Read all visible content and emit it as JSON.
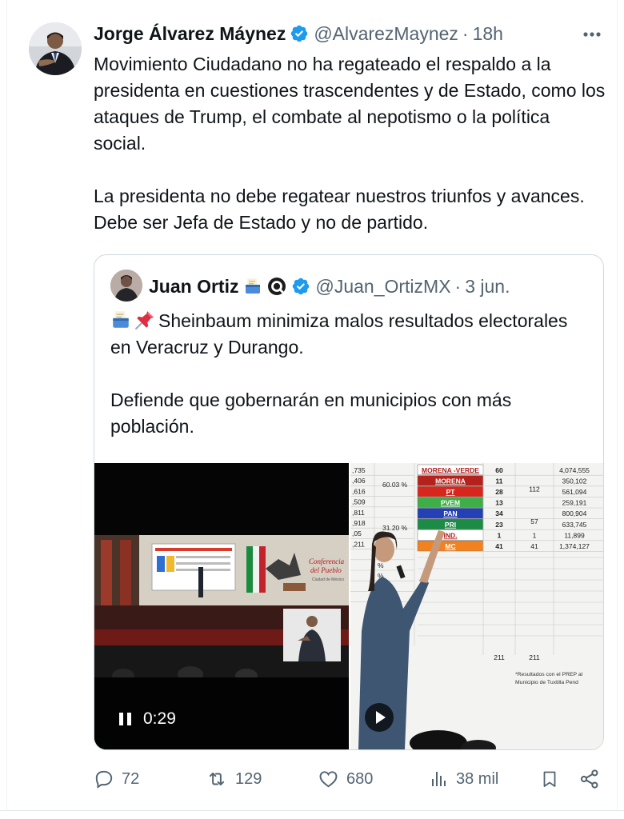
{
  "tweet": {
    "author_name": "Jorge Álvarez Máynez",
    "handle": "@AlvarezMaynez",
    "separator": "·",
    "time": "18h",
    "paragraphs": [
      "Movimiento Ciudadano no ha regateado el respaldo a la presidenta en cuestiones trascendentes y de Estado, como los ataques de Trump, el combate al nepotismo o la política social.",
      "La presidenta no debe regatear nuestros triunfos y avances. Debe ser Jefa de Estado y no de partido."
    ]
  },
  "quote": {
    "author_name": "Juan Ortiz",
    "handle": "@Juan_OrtizMX",
    "separator": "·",
    "time": "3 jun.",
    "paragraph1": "Sheinbaum minimiza malos resultados electorales en Veracruz y Durango.",
    "paragraph2": "Defiende que gobernarán en municipios con más población.",
    "video": {
      "elapsed": "0:29",
      "slide_title": "Conferencia\ndel Pueblo",
      "slide_subtitle": "Ciudad de México"
    },
    "results_table": {
      "left_numbers": [
        ",735",
        ",406",
        ",616",
        ",509",
        ",811",
        ",918",
        ",05",
        ",211",
        "",
        "",
        "",
        "",
        ""
      ],
      "percent_top": "60.03 %",
      "percent_bottom": "31.20 %",
      "rows": [
        {
          "party": "MORENA -VERDE",
          "seats": "60",
          "group": "",
          "votes": "4,074,555",
          "color": "#ffffff"
        },
        {
          "party": "MORENA",
          "seats": "11",
          "group": "112",
          "votes": "350,102",
          "color": "#b5221c"
        },
        {
          "party": "PT",
          "seats": "28",
          "group": "",
          "votes": "561,094",
          "color": "#d9261c"
        },
        {
          "party": "PVEM",
          "seats": "13",
          "group": "",
          "votes": "259,191",
          "color": "#3fae49"
        },
        {
          "party": "PAN",
          "seats": "34",
          "group": "57",
          "votes": "800,904",
          "color": "#2340b4"
        },
        {
          "party": "PRI",
          "seats": "23",
          "group": "",
          "votes": "633,745",
          "color": "#1b8b45"
        },
        {
          "party": "IND.",
          "seats": "1",
          "group": "1",
          "votes": "11,899",
          "color": "#ffffff"
        },
        {
          "party": "MC",
          "seats": "41",
          "group": "41",
          "votes": "1,374,127",
          "color": "#f28220"
        }
      ],
      "total_left": "211",
      "total_right": "211",
      "footnote": "*Resultados con el PREP al\nMunicipio de Tuxtilla Pend"
    }
  },
  "actions": {
    "replies": "72",
    "reposts": "129",
    "likes": "680",
    "views": "38 mil"
  },
  "icons": {
    "verified": "verified-badge-icon",
    "more": "more-options-icon",
    "ballot": "ballot-box-emoji",
    "pushpin": "pushpin-emoji",
    "threads": "threads-icon"
  },
  "colors": {
    "text": "#0f1419",
    "muted": "#536471",
    "verified": "#1d9bf0",
    "border": "#cfd9de"
  }
}
